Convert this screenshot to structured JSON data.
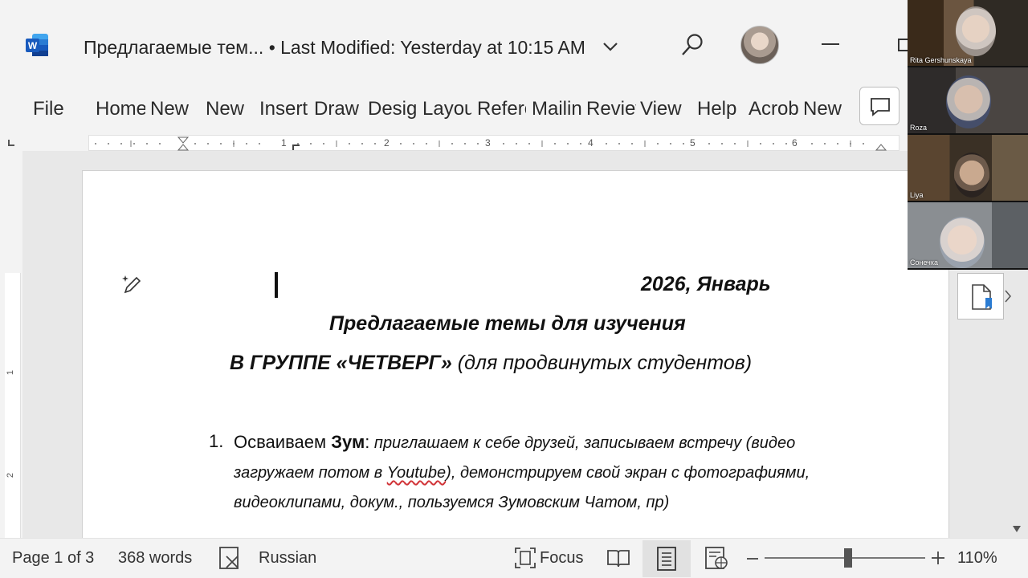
{
  "titlebar": {
    "doc_name": "Предлагаемые тем...",
    "separator": "•",
    "last_modified": "Last Modified: Yesterday at 10:15 AM",
    "brand_color": "#185abd"
  },
  "ribbon": {
    "tabs": [
      "File",
      "Home",
      "New",
      "New",
      "Insert",
      "Draw",
      "Design",
      "Layout",
      "References",
      "Mailings",
      "Review",
      "View",
      "Help",
      "Acrobat",
      "New"
    ]
  },
  "ruler": {
    "numbers": [
      "1",
      "2",
      "3",
      "4",
      "5",
      "6"
    ],
    "vertical_numbers": [
      "1",
      "2"
    ]
  },
  "document": {
    "date_line": "2026, Январь",
    "heading1": "Предлагаемые темы для изучения",
    "heading2_bold": "В  ГРУППЕ  «ЧЕТВЕРГ»",
    "heading2_italic": " (для продвинутых студентов)",
    "list_number": "1.",
    "item1_lead": "Осваиваем ",
    "item1_bold": "Зум",
    "item1_colon": ":",
    "item1_line1_rest": " приглашаем к себе друзей, записываем встречу (видео",
    "item1_line2_a": "загружаем потом в ",
    "item1_line2_misspelled": "Youtube",
    "item1_line2_b": "), демонстрируем свой экран с фотографиями,",
    "item1_line3": "видеоклипами, докум., пользуемся Зумовским Чатом, пр)"
  },
  "statusbar": {
    "page": "Page 1 of 3",
    "words": "368 words",
    "language": "Russian",
    "focus": "Focus",
    "zoom_level": "110%",
    "zoom_fraction": 0.52
  },
  "zoom_participants": [
    {
      "name": "Rita Gershunskaya",
      "bg": "#5a4a3a",
      "face": "#d9c7b8"
    },
    {
      "name": "Roza",
      "bg": "#3b3a3a",
      "face": "#d3b9a7"
    },
    {
      "name": "Liya",
      "bg": "#4a4030",
      "face": "#c4a690"
    },
    {
      "name": "Сонечка",
      "bg": "#6a6e72",
      "face": "#e2cfc2"
    }
  ]
}
